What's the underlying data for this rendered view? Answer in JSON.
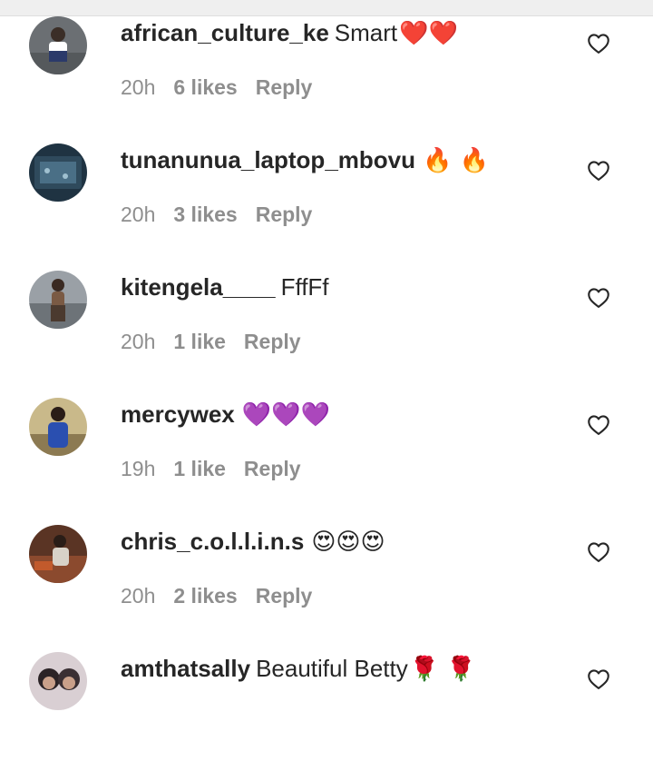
{
  "comments": [
    {
      "username": "african_culture_ke",
      "text": "Smart",
      "emoji": "❤️❤️",
      "time": "20h",
      "likes": "6 likes",
      "reply": "Reply",
      "avatar_icon": "avatar-photo",
      "avatar_color": "#6b6f73"
    },
    {
      "username": "tunanunua_laptop_mbovu",
      "text": "",
      "emoji": "🔥 🔥",
      "time": "20h",
      "likes": "3 likes",
      "reply": "Reply",
      "avatar_icon": "avatar-photo",
      "avatar_color": "#2f4a5c"
    },
    {
      "username": "kitengela____",
      "text": "FffFf",
      "emoji": "",
      "time": "20h",
      "likes": "1 like",
      "reply": "Reply",
      "avatar_icon": "avatar-photo",
      "avatar_color": "#7a6a55"
    },
    {
      "username": "mercywex",
      "text": "",
      "emoji": "💜💜💜",
      "time": "19h",
      "likes": "1 like",
      "reply": "Reply",
      "avatar_icon": "avatar-photo",
      "avatar_color": "#8c7a52"
    },
    {
      "username": "chris_c.o.l.l.i.n.s",
      "text": "",
      "emoji": "😍😍😍",
      "time": "20h",
      "likes": "2 likes",
      "reply": "Reply",
      "avatar_icon": "avatar-photo",
      "avatar_color": "#8b4a2e"
    },
    {
      "username": "amthatsally",
      "text": "Beautiful Betty",
      "emoji": "🌹 🌹",
      "time": "",
      "likes": "",
      "reply": "",
      "avatar_icon": "avatar-photo",
      "avatar_color": "#b8aab0"
    }
  ],
  "colors": {
    "username": "#262626",
    "meta": "#8e8e8e",
    "heart_outline": "#262626",
    "top_bar": "#efefef"
  },
  "icons": {
    "like": "heart-outline-icon"
  }
}
